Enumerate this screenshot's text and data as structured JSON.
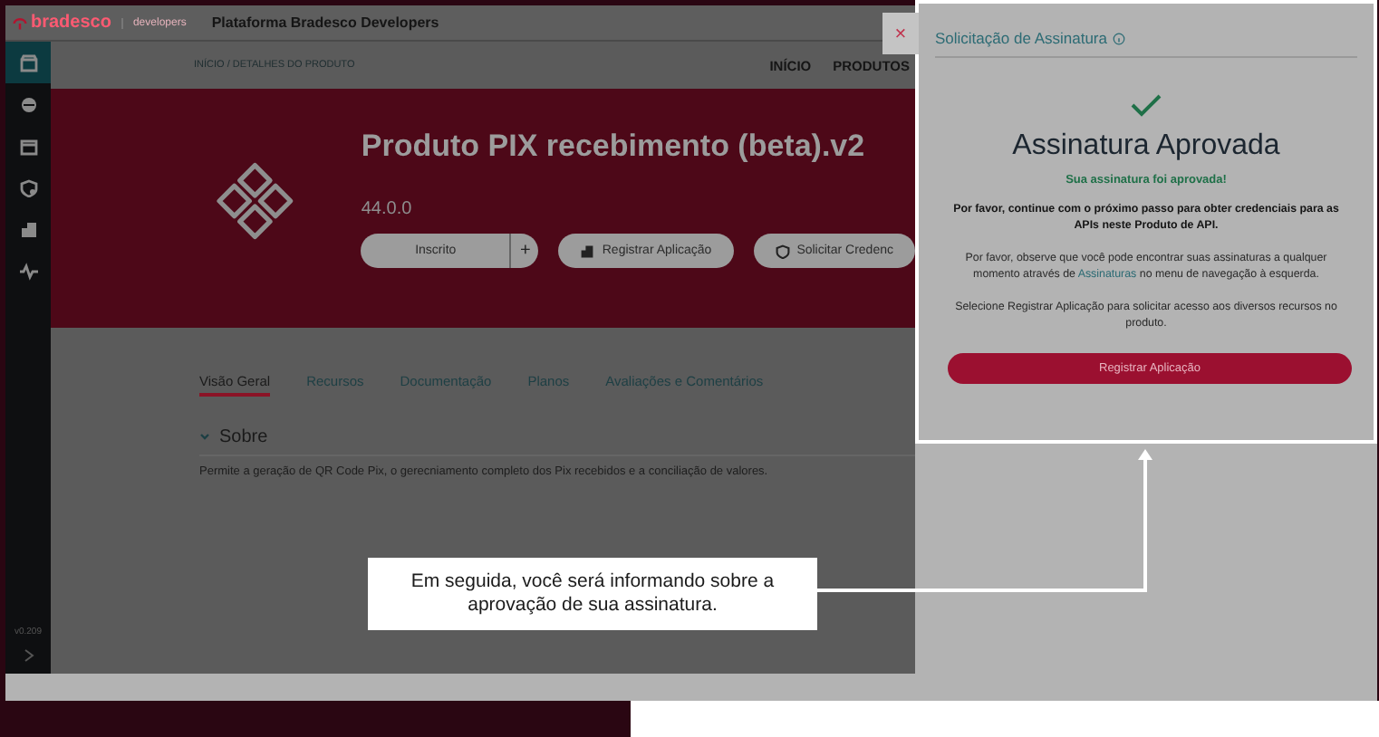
{
  "header": {
    "brand": "bradesco",
    "sub_brand": "developers",
    "title": "Plataforma Bradesco Developers"
  },
  "sidebar": {
    "items": [
      {
        "selected": true
      },
      {
        "selected": false
      },
      {
        "selected": false
      },
      {
        "selected": false
      },
      {
        "selected": false
      },
      {
        "selected": false
      }
    ],
    "version": "v0.209"
  },
  "breadcrumb": "INÍCIO / DETALHES DO PRODUTO",
  "nav": [
    {
      "label": "INÍCIO"
    },
    {
      "label": "PRODUTOS"
    }
  ],
  "product": {
    "title": "Produto PIX recebimento (beta).v2",
    "version": "44.0.0",
    "buttons": [
      {
        "kind": "split",
        "label": "Inscrito",
        "addon": "+"
      },
      {
        "kind": "icon",
        "label": "Registrar Aplicação"
      },
      {
        "kind": "icon",
        "label": "Solicitar Credenc"
      }
    ]
  },
  "tabs": [
    {
      "label": "Visão Geral",
      "selected": true
    },
    {
      "label": "Recursos",
      "selected": false
    },
    {
      "label": "Documentação",
      "selected": false
    },
    {
      "label": "Planos",
      "selected": false
    },
    {
      "label": "Avaliações e Comentários",
      "selected": false
    }
  ],
  "section": {
    "title": "Sobre",
    "expanded": true,
    "text": "Permite a geração de QR Code Pix, o gerecniamento completo dos Pix recebidos e a conciliação de valores."
  },
  "close_button": "×",
  "panel": {
    "title": "Solicitação de Assinatura",
    "heading": "Assinatura Aprovada",
    "status": "Sua assinatura foi aprovada!",
    "paragraphs": [
      {
        "kind": "bold",
        "text": "Por favor, continue com o próximo passo para obter credenciais para as APIs neste Produto de API."
      },
      {
        "kind": "link",
        "before": "Por favor, observe que você pode encontrar suas assinaturas a qualquer momento através de ",
        "link": "Assinaturas",
        "after": " no menu de navegação à esquerda."
      },
      {
        "kind": "plain",
        "text": "Selecione Registrar Aplicação para solicitar acesso aos diversos recursos no produto."
      }
    ],
    "button": "Registrar Aplicação"
  },
  "callout": "Em seguida, você será informando sobre a aprovação de sua assinatura."
}
